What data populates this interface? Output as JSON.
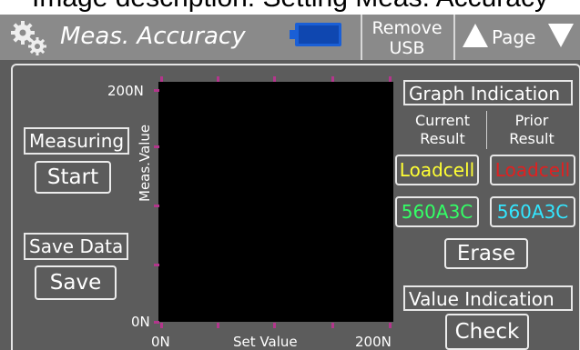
{
  "caption": "Image description: Setting Meas. Accuracy",
  "header": {
    "title": "Meas. Accuracy",
    "remove_usb_line1": "Remove",
    "remove_usb_line2": "USB",
    "page_label": "Page"
  },
  "measuring": {
    "label": "Measuring",
    "start_button": "Start"
  },
  "save_data": {
    "label": "Save Data",
    "save_button": "Save"
  },
  "graph": {
    "y_max": "200N",
    "y_min": "0N",
    "x_min": "0N",
    "x_max": "200N",
    "y_label": "Meas.Value",
    "x_label": "Set Value"
  },
  "graph_indication": {
    "title": "Graph Indication",
    "current_result_line1": "Current",
    "current_result_line2": "Result",
    "prior_result_line1": "Prior",
    "prior_result_line2": "Result",
    "current_loadcell": "Loadcell",
    "prior_loadcell": "Loadcell",
    "current_sensor": "560A3C",
    "prior_sensor": "560A3C",
    "colors": {
      "current_loadcell": "#ffff33",
      "prior_loadcell": "#e02020",
      "current_sensor": "#33ff66",
      "prior_sensor": "#33e6ff"
    }
  },
  "erase_button": "Erase",
  "value_indication": {
    "title": "Value Indication",
    "check_button": "Check"
  }
}
